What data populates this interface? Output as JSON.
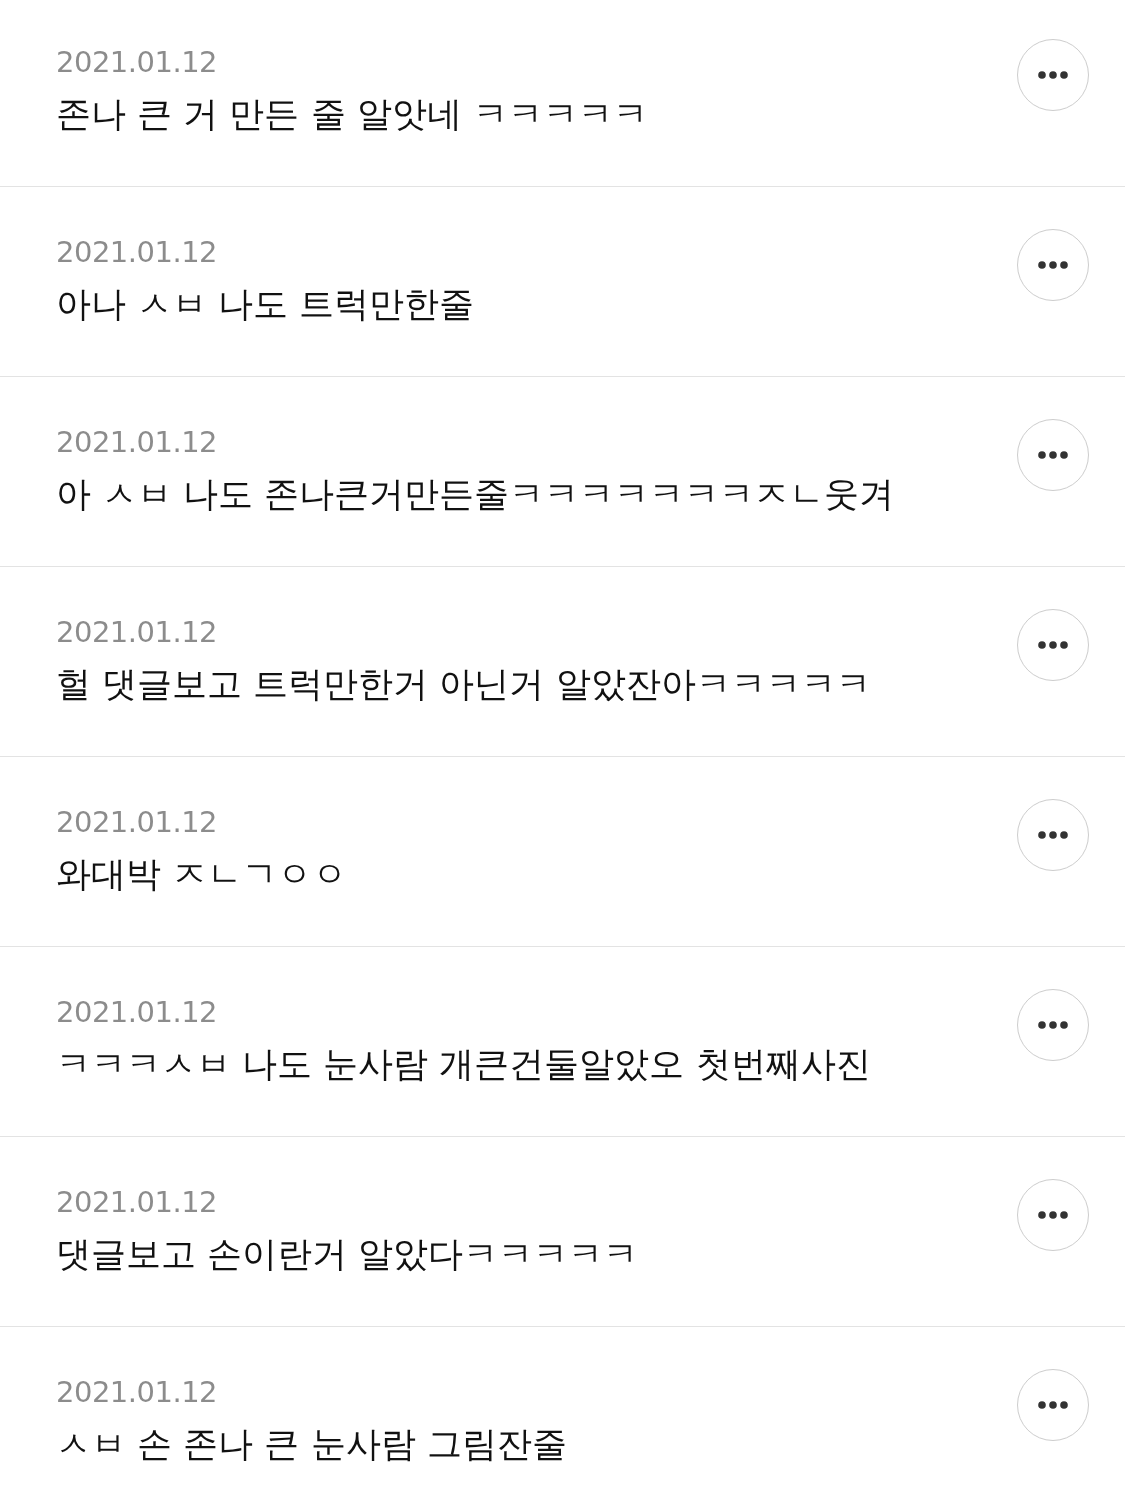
{
  "comments": [
    {
      "date": "2021.01.12",
      "text": "존나 큰 거 만든 줄 알앗네 ㅋㅋㅋㅋㅋ"
    },
    {
      "date": "2021.01.12",
      "text": "아나 ㅅㅂ 나도 트럭만한줄"
    },
    {
      "date": "2021.01.12",
      "text": "아 ㅅㅂ 나도 존나큰거만든줄ㅋㅋㅋㅋㅋㅋㅋㅈㄴ웃겨"
    },
    {
      "date": "2021.01.12",
      "text": "헐 댓글보고 트럭만한거 아닌거 알았잔아ㅋㅋㅋㅋㅋ"
    },
    {
      "date": "2021.01.12",
      "text": "와대박 ㅈㄴㄱㅇㅇ"
    },
    {
      "date": "2021.01.12",
      "text": "ㅋㅋㅋㅅㅂ 나도 눈사람 개큰건둘알았오 첫번째사진"
    },
    {
      "date": "2021.01.12",
      "text": "댓글보고 손이란거 알았다ㅋㅋㅋㅋㅋ"
    },
    {
      "date": "2021.01.12",
      "text": "ㅅㅂ 손 존나 큰 눈사람 그림잔줄"
    }
  ]
}
